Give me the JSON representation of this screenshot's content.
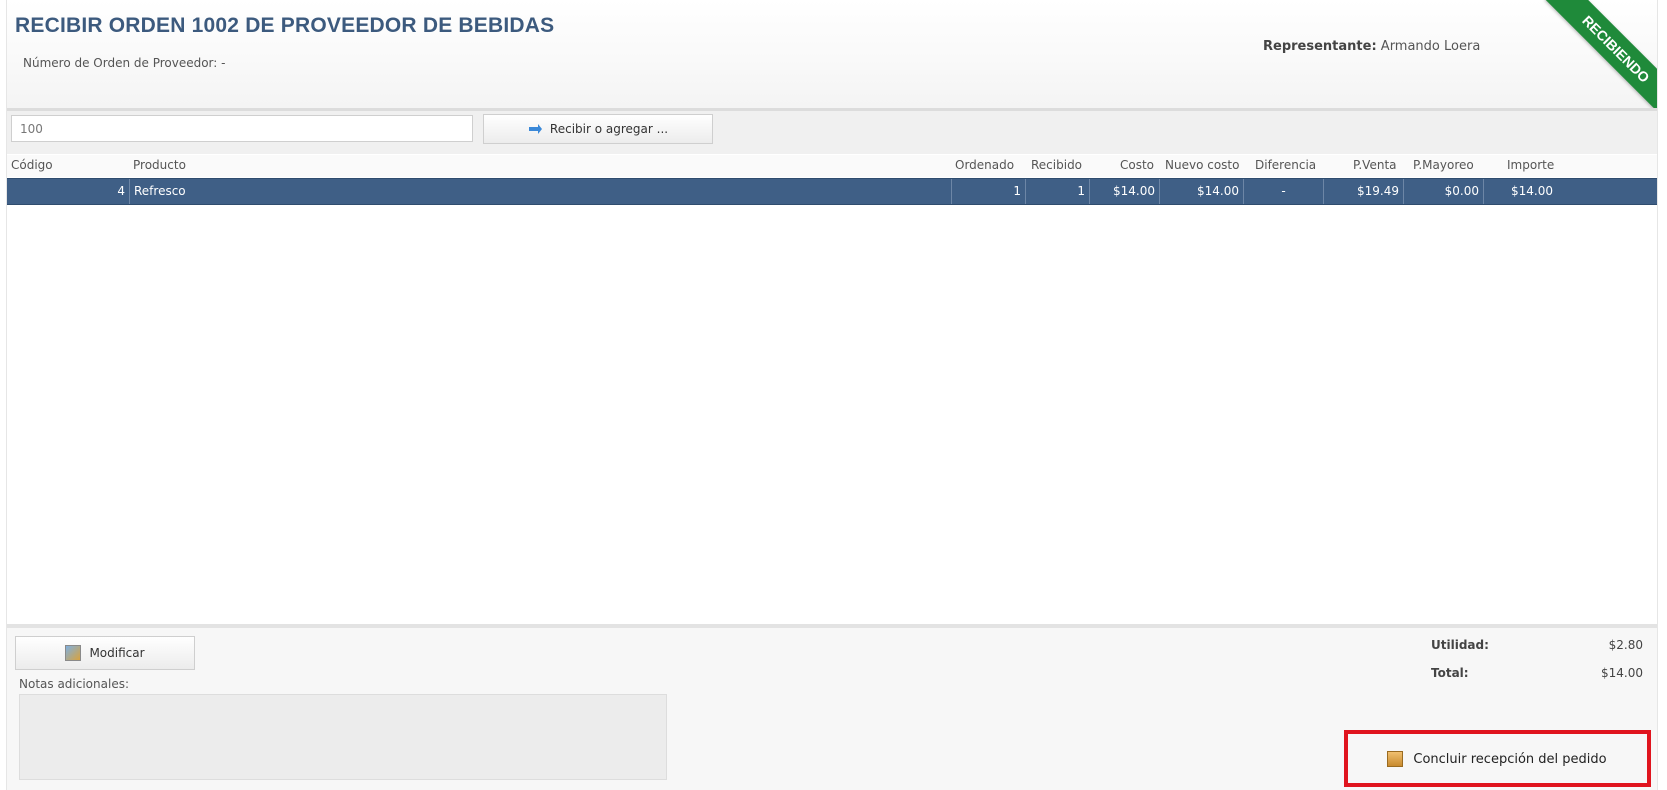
{
  "header": {
    "title": "RECIBIR ORDEN 1002 DE PROVEEDOR DE BEBIDAS",
    "supplier_order_label": "Número de Orden de Proveedor: -",
    "representative_label": "Representante:",
    "representative_value": "Armando Loera",
    "status_ribbon": "RECIBIENDO"
  },
  "toolbar": {
    "search_value": "100",
    "receive_button": "Recibir o agregar ..."
  },
  "table": {
    "columns": [
      "Código",
      "Producto",
      "Ordenado",
      "Recibido",
      "Costo",
      "Nuevo costo",
      "Diferencia",
      "P.Venta",
      "P.Mayoreo",
      "Importe"
    ],
    "rows": [
      {
        "codigo": "4",
        "producto": "Refresco",
        "ordenado": "1",
        "recibido": "1",
        "costo": "$14.00",
        "nuevo_costo": "$14.00",
        "diferencia": "-",
        "p_venta": "$19.49",
        "p_mayoreo": "$0.00",
        "importe": "$14.00"
      }
    ]
  },
  "footer": {
    "modify_button": "Modificar",
    "notes_label": "Notas adicionales:",
    "utility_label": "Utilidad:",
    "utility_value": "$2.80",
    "total_label": "Total:",
    "total_value": "$14.00",
    "conclude_button": "Concluir recepción del pedido"
  },
  "colors": {
    "title": "#3c5a7e",
    "selected_row": "#3f5f86",
    "ribbon": "#1f8a3a",
    "highlight": "#e0141e"
  },
  "icons": {
    "receive": "arrow-icon",
    "modify": "pencil-icon",
    "conclude": "box-icon"
  }
}
